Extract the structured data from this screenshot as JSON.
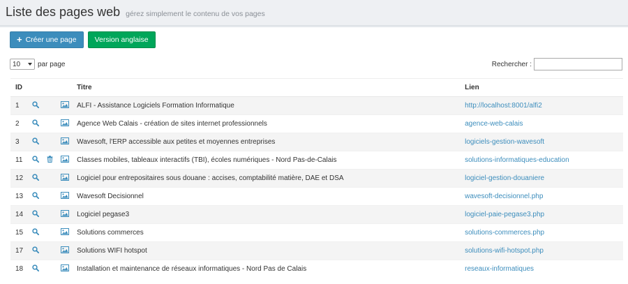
{
  "header": {
    "title": "Liste des pages web",
    "subtitle": "gérez simplement le contenu de vos pages"
  },
  "toolbar": {
    "create_label": "Créer une page",
    "english_label": "Version anglaise"
  },
  "length": {
    "value": "10",
    "suffix": "par page"
  },
  "search": {
    "label": "Rechercher :",
    "value": ""
  },
  "table": {
    "headers": {
      "id": "ID",
      "title": "Titre",
      "link": "Lien"
    },
    "rows": [
      {
        "id": "1",
        "title": "ALFI - Assistance Logiciels Formation Informatique",
        "link": "http://localhost:8001/alfi2",
        "trash": false
      },
      {
        "id": "2",
        "title": "Agence Web Calais - création de sites internet professionnels",
        "link": "agence-web-calais",
        "trash": false
      },
      {
        "id": "3",
        "title": "Wavesoft, l'ERP accessible aux petites et moyennes entreprises",
        "link": "logiciels-gestion-wavesoft",
        "trash": false
      },
      {
        "id": "11",
        "title": "Classes mobiles, tableaux interactifs (TBI), écoles numériques - Nord Pas-de-Calais",
        "link": "solutions-informatiques-education",
        "trash": true
      },
      {
        "id": "12",
        "title": "Logiciel pour entrepositaires sous douane : accises, comptabilité matière, DAE et DSA",
        "link": "logiciel-gestion-douaniere",
        "trash": false
      },
      {
        "id": "13",
        "title": "Wavesoft Decisionnel",
        "link": "wavesoft-decisionnel.php",
        "trash": false
      },
      {
        "id": "14",
        "title": "Logiciel pegase3",
        "link": "logiciel-paie-pegase3.php",
        "trash": false
      },
      {
        "id": "15",
        "title": "Solutions commerces",
        "link": "solutions-commerces.php",
        "trash": false
      },
      {
        "id": "17",
        "title": "Solutions WIFI hotspot",
        "link": "solutions-wifi-hotspot.php",
        "trash": false
      },
      {
        "id": "18",
        "title": "Installation et maintenance de réseaux informatiques - Nord Pas de Calais",
        "link": "reseaux-informatiques",
        "trash": false
      }
    ]
  },
  "icons": {
    "view": "search-icon",
    "delete": "trash-icon",
    "image": "image-icon",
    "create": "plus-icon"
  },
  "colors": {
    "primary": "#3c8dbc",
    "success": "#00a65a",
    "link": "#3c8dbc"
  }
}
